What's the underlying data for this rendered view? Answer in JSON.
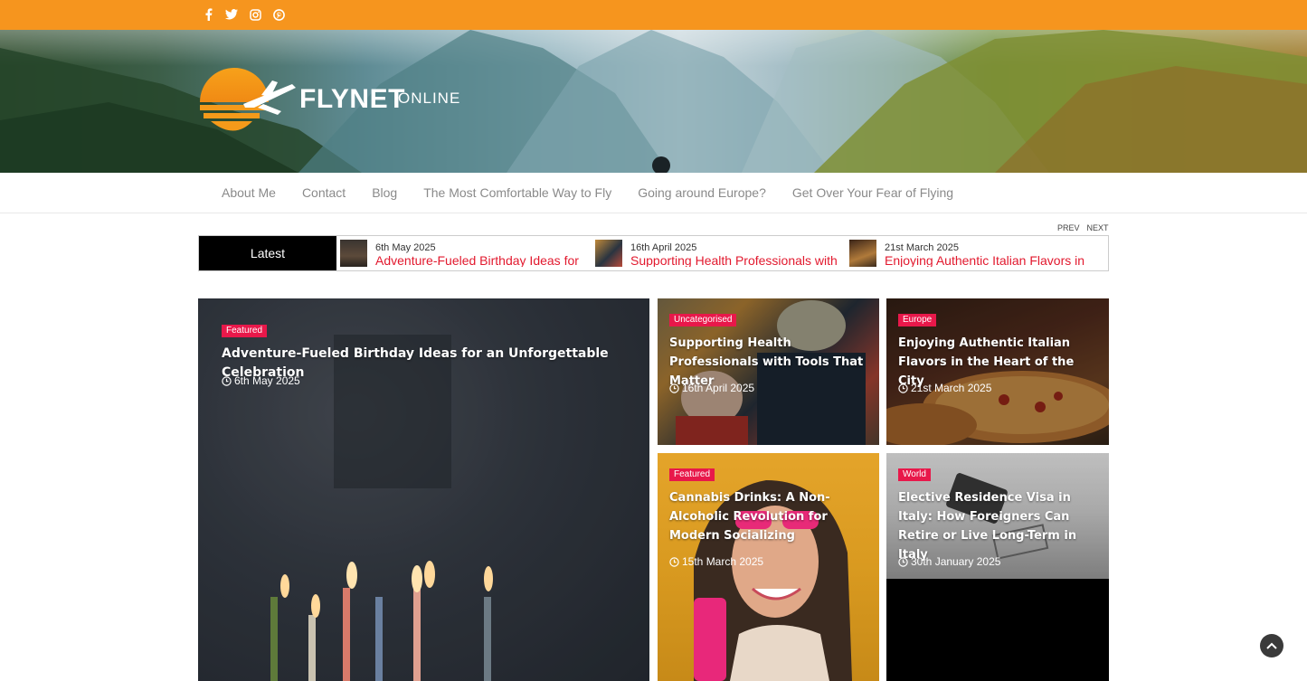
{
  "colors": {
    "topbar": "#f6951e",
    "tag": "#e8184a",
    "ticker_title": "#e2192e"
  },
  "social": [
    {
      "icon": "facebook-icon"
    },
    {
      "icon": "twitter-icon"
    },
    {
      "icon": "instagram-icon"
    },
    {
      "icon": "pinterest-icon"
    }
  ],
  "logo": {
    "brand": "FLYNET",
    "sub": "ONLINE"
  },
  "nav": {
    "items": [
      "About Me",
      "Contact",
      "Blog",
      "The Most Comfortable Way to Fly",
      "Going around Europe?",
      "Get Over Your Fear of Flying"
    ]
  },
  "ticker": {
    "label": "Latest",
    "prev": "PREV",
    "next": "NEXT",
    "items": [
      {
        "date": "6th May 2025",
        "title": "Adventure-Fueled Birthday Ideas for"
      },
      {
        "date": "16th April 2025",
        "title": "Supporting Health Professionals with"
      },
      {
        "date": "21st March 2025",
        "title": "Enjoying Authentic Italian Flavors in"
      }
    ]
  },
  "cards": [
    {
      "tag": "Featured",
      "title": "Adventure-Fueled Birthday Ideas for an Unforgettable Celebration",
      "date": "6th May 2025"
    },
    {
      "tag": "Uncategorised",
      "title": "Supporting Health Professionals with Tools That Matter",
      "date": "16th April 2025"
    },
    {
      "tag": "Europe",
      "title": "Enjoying Authentic Italian Flavors in the Heart of the City",
      "date": "21st March 2025"
    },
    {
      "tag": "Featured",
      "title": "Cannabis Drinks: A Non-Alcoholic Revolution for Modern Socializing",
      "date": "15th March 2025"
    },
    {
      "tag": "World",
      "title": "Elective Residence Visa in Italy: How Foreigners Can Retire or Live Long-Term in Italy",
      "date": "30th January 2025"
    }
  ]
}
